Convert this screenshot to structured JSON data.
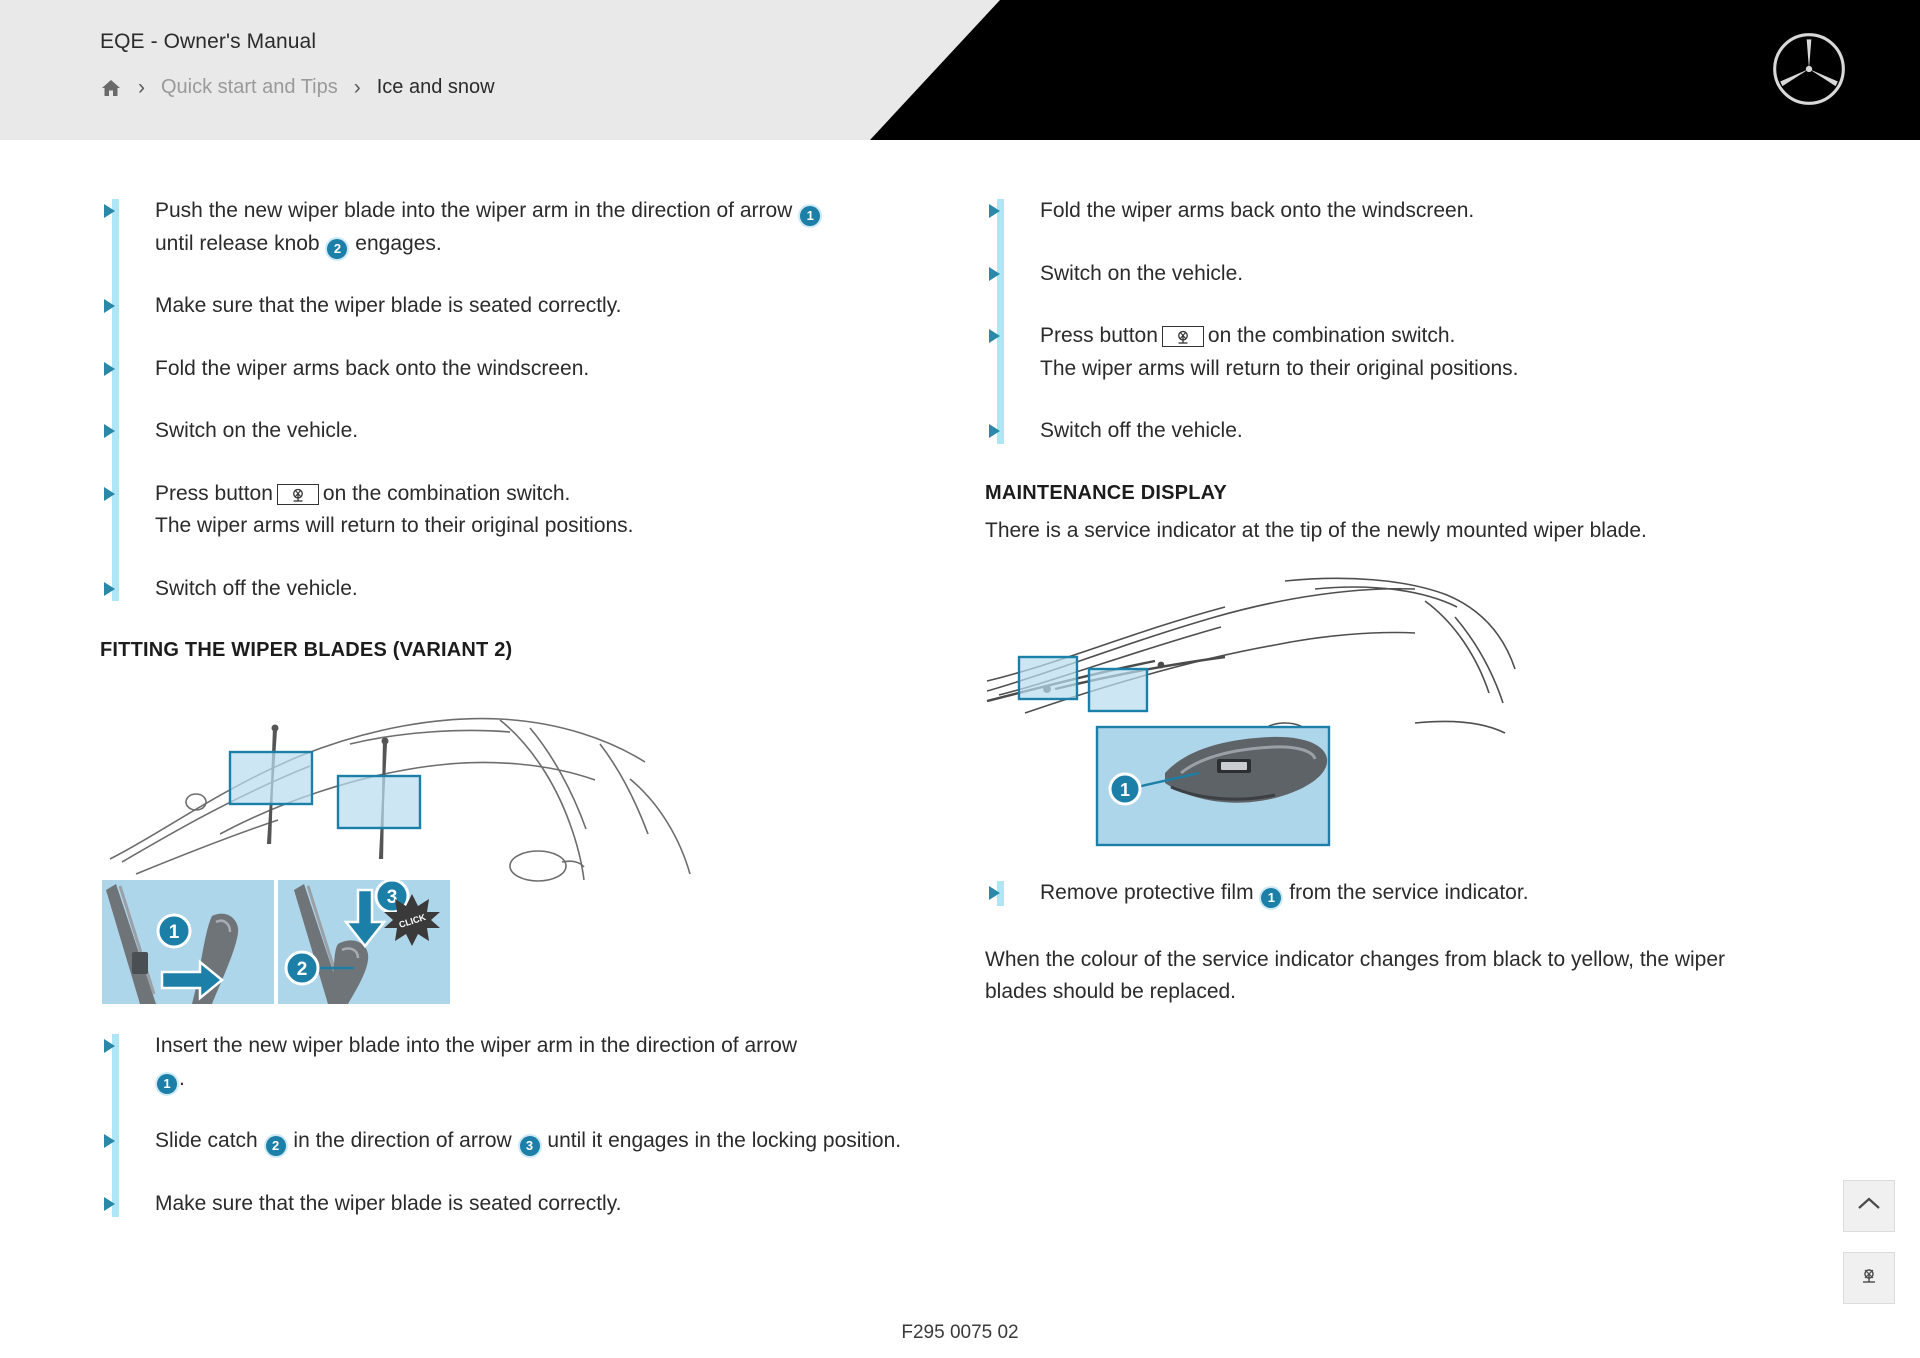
{
  "header": {
    "manual_title": "EQE - Owner's Manual",
    "breadcrumb": {
      "home_icon": "home-icon",
      "separator": "›",
      "parent": "Quick start and Tips",
      "current": "Ice and snow"
    },
    "logo": "mercedes-benz-star-logo",
    "accent_color": "#000000",
    "bar_color": "#e9e9e9"
  },
  "colors": {
    "accent_blue": "#1b7fa8",
    "accent_bar": "#aee6f5",
    "bullet_triangle": "#2a88a8",
    "panel_fill": "#aed6ea",
    "text": "#2b2b2b"
  },
  "left_column": {
    "steps_top": [
      {
        "pre": "Push the new wiper blade into the wiper arm in the direction of arrow",
        "num1": "1",
        "mid": "until release knob",
        "num2": "2",
        "post": "engages."
      },
      {
        "text": "Make sure that the wiper blade is seated correctly."
      },
      {
        "text": "Fold the wiper arms back onto the windscreen."
      },
      {
        "text": "Switch on the vehicle."
      },
      {
        "pre": "Press button",
        "icon": "wiper-button-icon",
        "post": "on the combination switch.",
        "sub": "The wiper arms will return to their original positions."
      },
      {
        "text": "Switch off the vehicle."
      }
    ],
    "section_heading": "FITTING THE WIPER BLADES (VARIANT 2)",
    "figure": {
      "name": "wiper-blade-fitting-variant2-illustration",
      "callouts": [
        "1",
        "2",
        "3"
      ],
      "click_label": "CLICK"
    },
    "steps_bottom": [
      {
        "pre": "Insert the new wiper blade into the wiper arm in the direction of arrow",
        "num1": "1",
        "post": "."
      },
      {
        "pre": "Slide catch",
        "num1": "2",
        "mid": "in the direction of arrow",
        "num2": "3",
        "post": "until it engages in the locking position."
      },
      {
        "text": "Make sure that the wiper blade is seated correctly."
      }
    ]
  },
  "right_column": {
    "steps_top": [
      {
        "text": "Fold the wiper arms back onto the windscreen."
      },
      {
        "text": "Switch on the vehicle."
      },
      {
        "pre": "Press button",
        "icon": "wiper-button-icon",
        "post": "on the combination switch.",
        "sub": "The wiper arms will return to their original positions."
      },
      {
        "text": "Switch off the vehicle."
      }
    ],
    "section_heading": "MAINTENANCE DISPLAY",
    "intro": "There is a service indicator at the tip of the newly mounted wiper blade.",
    "figure": {
      "name": "service-indicator-illustration",
      "callouts": [
        "1"
      ]
    },
    "step_after_figure": {
      "pre": "Remove protective film",
      "num1": "1",
      "post": "from the service indicator."
    },
    "closing_paragraph": "When the colour of the service indicator changes from black to yellow, the wiper blades should be replaced."
  },
  "floating_buttons": [
    {
      "name": "scroll-to-top-button",
      "icon": "chevron-up-icon"
    },
    {
      "name": "wiper-tool-button",
      "icon": "wiper-icon"
    }
  ],
  "footer": {
    "code": "F295 0075 02"
  }
}
